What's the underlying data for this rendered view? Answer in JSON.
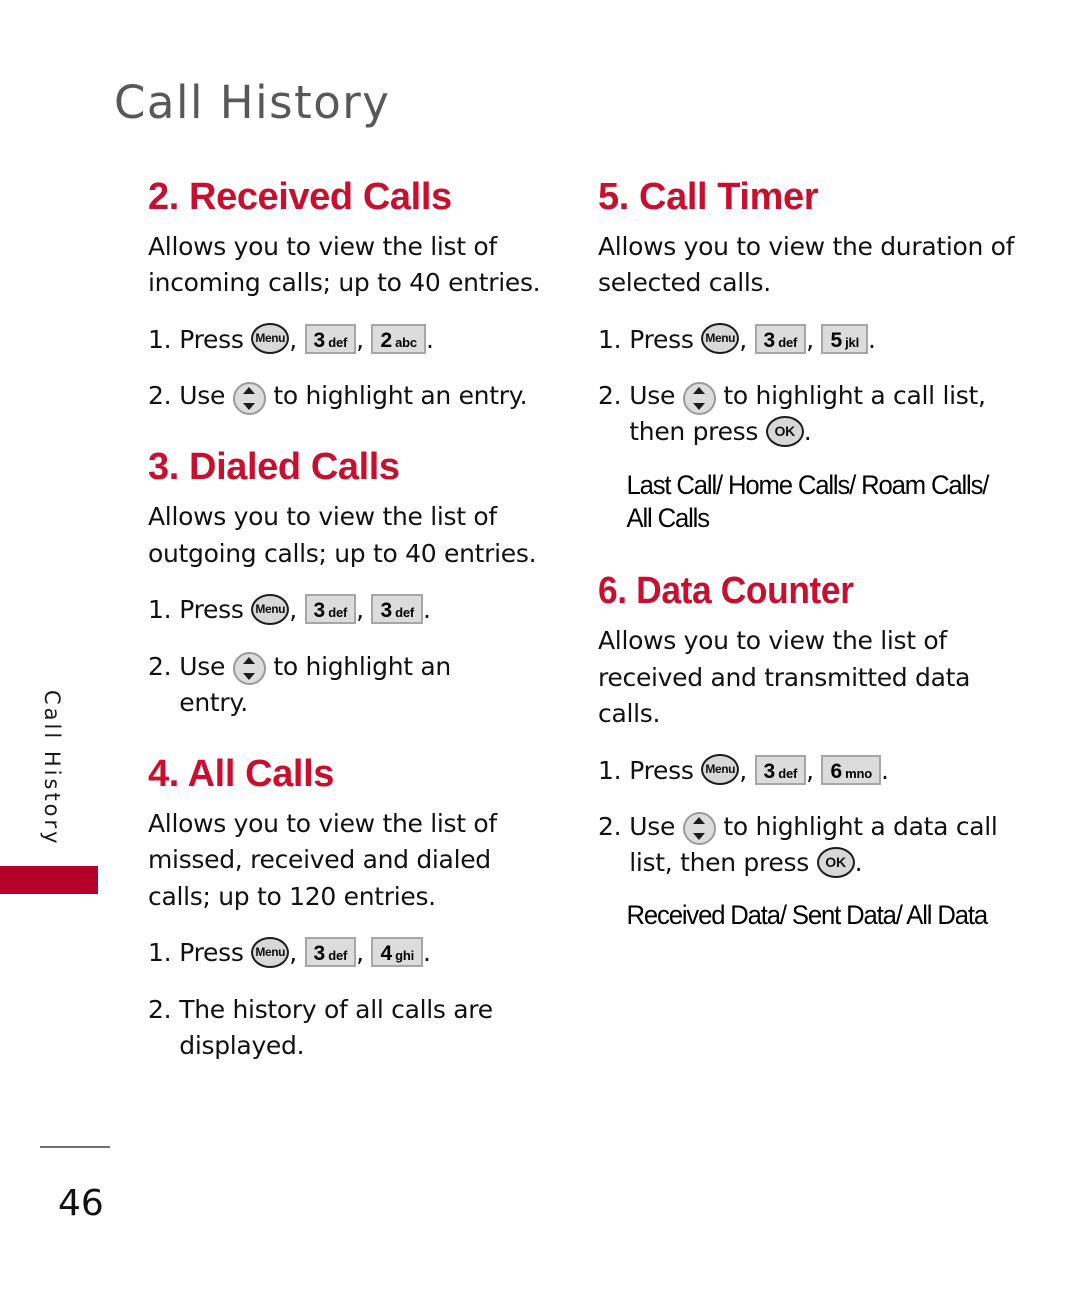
{
  "page": {
    "title": "Call History",
    "number": "46",
    "accent_color": "#c8102e",
    "tab_color": "#b5002c",
    "title_color": "#58585a"
  },
  "side_tab": {
    "label": "Call History"
  },
  "keys": {
    "menu": "Menu",
    "ok": "OK",
    "nav": "nav-up-down",
    "k2": {
      "digit": "2",
      "letters": "abc"
    },
    "k3": {
      "digit": "3",
      "letters": "def"
    },
    "k4": {
      "digit": "4",
      "letters": "ghi"
    },
    "k5": {
      "digit": "5",
      "letters": "jkl"
    },
    "k6": {
      "digit": "6",
      "letters": "mno"
    }
  },
  "sections": {
    "received_calls": {
      "heading": "2. Received Calls",
      "description": "Allows you to view the list of incoming calls; up to 40 entries.",
      "step1_num": "1.",
      "step1_verb": "Press",
      "step1_sep": ",",
      "step1_end": ".",
      "step2_num": "2.",
      "step2_verb": "Use",
      "step2_tail": "to highlight an entry."
    },
    "dialed_calls": {
      "heading": "3. Dialed Calls",
      "description": "Allows you to view the list of outgoing calls; up to 40 entries.",
      "step1_num": "1.",
      "step1_verb": "Press",
      "step1_sep": ",",
      "step1_end": ".",
      "step2_num": "2.",
      "step2_verb": "Use",
      "step2_tail": "to highlight an entry."
    },
    "all_calls": {
      "heading": "4. All Calls",
      "description": "Allows you to view the list of missed, received and dialed calls; up to 120 entries.",
      "step1_num": "1.",
      "step1_verb": "Press",
      "step1_sep": ",",
      "step1_end": ".",
      "step2_num": "2.",
      "step2_text": "The history of all calls are displayed."
    },
    "call_timer": {
      "heading": "5. Call Timer",
      "description": "Allows you to view the duration of selected calls.",
      "step1_num": "1.",
      "step1_verb": "Press",
      "step1_sep": ",",
      "step1_end": ".",
      "step2_num": "2.",
      "step2_verb": "Use",
      "step2_tail": "to highlight a call list, then press",
      "step2_end": ".",
      "options": "Last Call/ Home Calls/ Roam Calls/ All Calls"
    },
    "data_counter": {
      "heading": "6. Data Counter",
      "description": "Allows you to view the list of received and transmitted data calls.",
      "step1_num": "1.",
      "step1_verb": "Press",
      "step1_sep": ",",
      "step1_end": ".",
      "step2_num": "2.",
      "step2_verb": "Use",
      "step2_tail": "to highlight a data call list, then press",
      "step2_end": ".",
      "options": "Received Data/ Sent Data/ All Data"
    }
  }
}
